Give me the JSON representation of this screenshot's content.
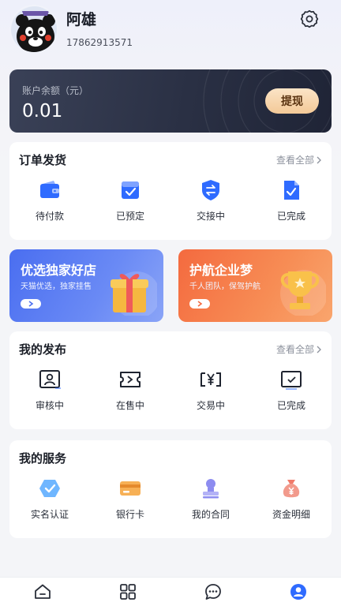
{
  "profile": {
    "name": "阿雄",
    "phone": "17862913571",
    "avatar_icon": "bear-avatar"
  },
  "balance": {
    "label": "账户余额（元）",
    "value": "0.01",
    "withdraw_label": "提现"
  },
  "orders": {
    "title": "订单发货",
    "more_label": "查看全部",
    "items": [
      {
        "label": "待付款",
        "icon": "wallet-icon"
      },
      {
        "label": "已预定",
        "icon": "box-check-icon"
      },
      {
        "label": "交接中",
        "icon": "shield-exchange-icon"
      },
      {
        "label": "已完成",
        "icon": "document-check-icon"
      }
    ]
  },
  "promos": [
    {
      "title": "优选独家好店",
      "subtitle": "天猫优选，独家挂售",
      "icon": "gift-icon"
    },
    {
      "title": "护航企业梦",
      "subtitle": "千人团队，保驾护航",
      "icon": "trophy-icon"
    }
  ],
  "publish": {
    "title": "我的发布",
    "more_label": "查看全部",
    "items": [
      {
        "label": "审核中",
        "icon": "id-card-icon"
      },
      {
        "label": "在售中",
        "icon": "ticket-icon"
      },
      {
        "label": "交易中",
        "icon": "yen-box-icon"
      },
      {
        "label": "已完成",
        "icon": "check-box-icon"
      }
    ]
  },
  "services": {
    "title": "我的服务",
    "items": [
      {
        "label": "实名认证",
        "icon": "verified-icon"
      },
      {
        "label": "银行卡",
        "icon": "bank-card-icon"
      },
      {
        "label": "我的合同",
        "icon": "stamp-icon"
      },
      {
        "label": "资金明细",
        "icon": "money-bag-icon"
      }
    ]
  },
  "nav": [
    "home-icon",
    "grid-icon",
    "chat-icon",
    "profile-icon"
  ],
  "colors": {
    "accent": "#2f6bff",
    "card_dark": "#2a3044",
    "withdraw": "#f3c998"
  }
}
